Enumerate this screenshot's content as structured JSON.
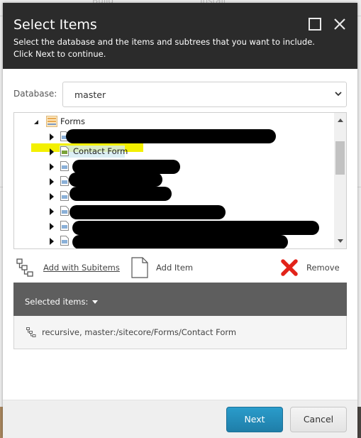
{
  "background": {
    "tabs": [
      "Build",
      "Install"
    ]
  },
  "dialog": {
    "title": "Select Items",
    "subtitle_line1": "Select the database and the items and subtrees that you want to include.",
    "subtitle_line2": "Click Next to continue.",
    "maximize_icon": "maximize-icon",
    "close_icon": "close-icon"
  },
  "database": {
    "label": "Database:",
    "selected": "master"
  },
  "tree": {
    "root": {
      "label": "Forms",
      "icon": "forms-folder-icon",
      "expanded": true
    },
    "items": [
      {
        "label": "[redacted]",
        "redacted": true,
        "icon": "form-item-icon"
      },
      {
        "label": "Contact Form",
        "redacted": false,
        "selected": true,
        "highlighted": true,
        "icon": "form-item-green-icon"
      },
      {
        "label": "[redacted]",
        "redacted": true,
        "icon": "form-item-icon"
      },
      {
        "label": "[redacted]",
        "redacted": true,
        "icon": "form-item-icon"
      },
      {
        "label": "[redacted]",
        "redacted": true,
        "icon": "form-item-icon"
      },
      {
        "label": "[redacted]",
        "redacted": true,
        "icon": "form-item-icon"
      },
      {
        "label": "[redacted]",
        "redacted": true,
        "icon": "form-item-icon"
      },
      {
        "label": "[redacted]",
        "redacted": true,
        "icon": "form-item-icon"
      }
    ]
  },
  "actions": {
    "add_with_subitems": "Add with Subitems",
    "add_item": "Add Item",
    "remove": "Remove"
  },
  "selected_items": {
    "header": "Selected items:",
    "items": [
      {
        "text": "recursive, master:/sitecore/Forms/Contact Form",
        "icon": "subtree-icon"
      }
    ]
  },
  "footer": {
    "next_label": "Next",
    "cancel_label": "Cancel"
  },
  "colors": {
    "header_bg": "#2b2b2b",
    "selected_header_bg": "#5e5e5e",
    "primary_button": "#2388b6",
    "remove_icon": "#e2231a",
    "highlight": "#f3f000"
  }
}
